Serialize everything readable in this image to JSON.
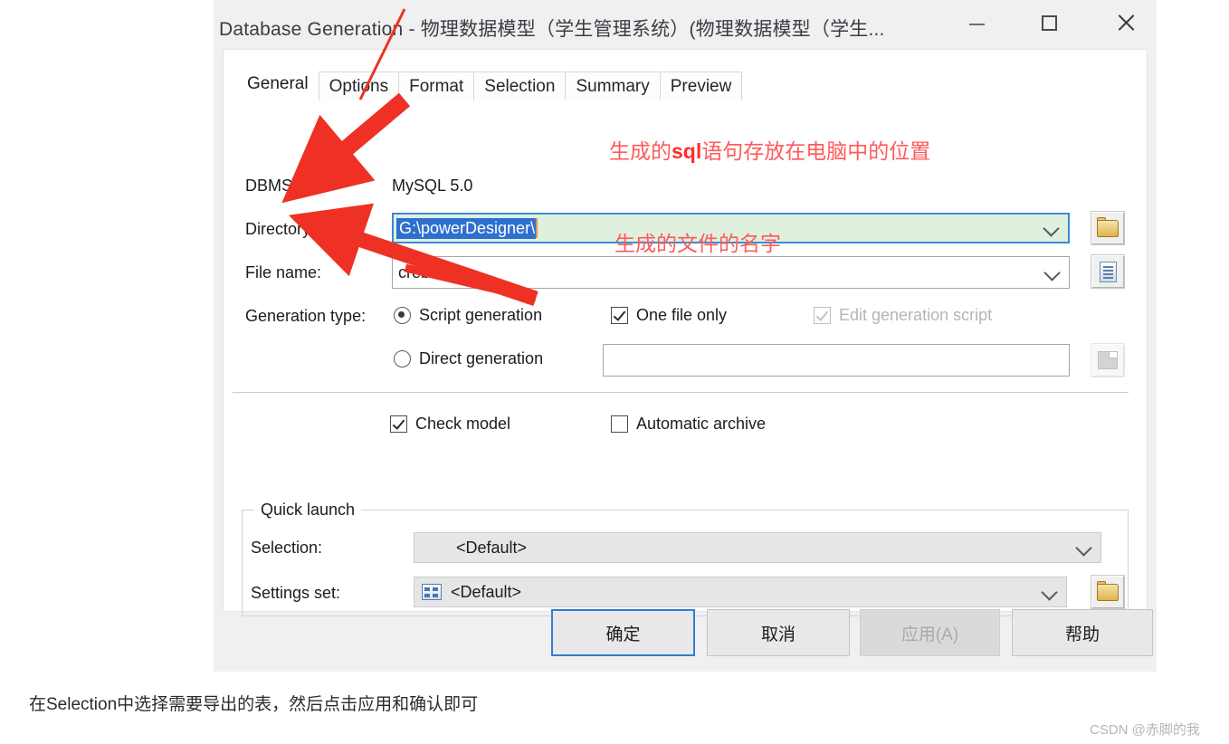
{
  "window": {
    "title": "Database Generation - 物理数据模型（学生管理系统）(物理数据模型（学生...",
    "minimize_label": "Minimize",
    "maximize_label": "Maximize",
    "close_label": "Close"
  },
  "tabs": [
    {
      "label": "General",
      "active": true
    },
    {
      "label": "Options",
      "active": false
    },
    {
      "label": "Format",
      "active": false
    },
    {
      "label": "Selection",
      "active": false
    },
    {
      "label": "Summary",
      "active": false
    },
    {
      "label": "Preview",
      "active": false
    }
  ],
  "general": {
    "dbms_label": "DBMS:",
    "dbms_value": "MySQL 5.0",
    "directory_label": "Directory:",
    "directory_value": "G:\\powerDesigner\\",
    "filename_label": "File name:",
    "filename_value": "crebas",
    "generation_type_label": "Generation type:",
    "script_generation_label": "Script generation",
    "direct_generation_label": "Direct generation",
    "one_file_only_label": "One file only",
    "edit_generation_script_label": "Edit generation script",
    "direct_generation_value": "",
    "check_model_label": "Check model",
    "automatic_archive_label": "Automatic archive"
  },
  "quick_launch": {
    "title": "Quick launch",
    "selection_label": "Selection:",
    "selection_value": "<Default>",
    "settings_set_label": "Settings set:",
    "settings_set_value": "<Default>"
  },
  "buttons": {
    "ok": "确定",
    "cancel": "取消",
    "apply": "应用(A)",
    "help": "帮助"
  },
  "annotations": {
    "directory_note_prefix": "生成的",
    "directory_note_bold": "sql",
    "directory_note_suffix": "语句存放在电脑中的位置",
    "filename_note": "生成的文件的名字"
  },
  "caption": "在Selection中选择需要导出的表，然后点击应用和确认即可",
  "watermark": "CSDN @赤脚的我",
  "colors": {
    "accent": "#2f7fd4",
    "selection_blue": "#2f6fd0",
    "focused_field_bg": "#dff0df",
    "annotation_red": "#ff5a5a",
    "window_bg": "#f0f0f0"
  }
}
